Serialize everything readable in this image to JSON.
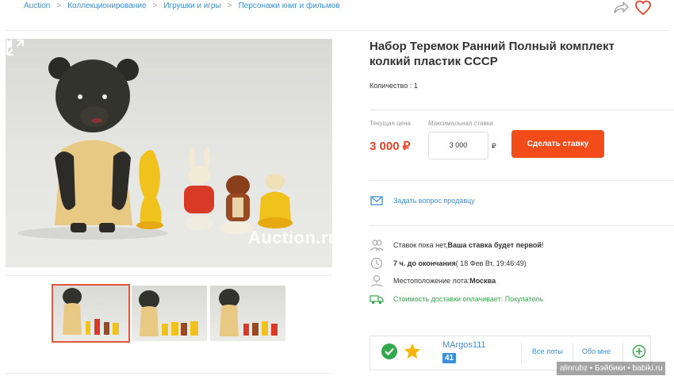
{
  "breadcrumb": [
    "Auction",
    "Коллекционирование",
    "Игрушки и игры",
    "Персонажи книг и фильмов"
  ],
  "breadcrumb_separator": ">",
  "lot": {
    "title": "Набор Теремок Ранний Полный комплект колкий пластик СССР",
    "quantity": "Количество : 1"
  },
  "gallery": {
    "watermark": "Auction.ru",
    "thumbnail_count": 3,
    "active_thumbnail": 1
  },
  "bidding": {
    "current_price_label": "Текущая цена",
    "current_price": "3 000 ₽",
    "max_bid_label": "Максимальная ставка",
    "max_bid_value": "3 000",
    "currency": "₽",
    "bid_button": "Сделать ставку"
  },
  "ask_seller": "Задать вопрос продавцу",
  "info": {
    "bids_prefix": "Ставок пока нет, ",
    "bids_bold": "Ваша ставка будет первой",
    "bids_suffix": "!",
    "time_bold": "7 ч. до окончания",
    "time_rest": " ( 18 Фев Вт, 19:46:49)",
    "location_label": "Местоположение лота: ",
    "location_value": "Москва",
    "delivery": "Стоимость доставки оплачивает: Покупатель"
  },
  "seller": {
    "name": "MArgos111",
    "rating": "41",
    "all_lots": "Все лоты",
    "about": "Обо мне"
  },
  "footer_watermark": "alinrubz • Бэйбики • babiki.ru",
  "colors": {
    "accent_blue": "#3a8fd9",
    "price_red": "#e8432a",
    "bid_button": "#f24c1b",
    "green": "#33a84a",
    "star": "#f5b400"
  },
  "icons": [
    "share-icon",
    "heart-icon",
    "expand-icon",
    "envelope-icon",
    "users-icon",
    "clock-icon",
    "location-pin-icon",
    "truck-icon",
    "check-circle-icon",
    "star-icon",
    "plus-circle-icon"
  ]
}
